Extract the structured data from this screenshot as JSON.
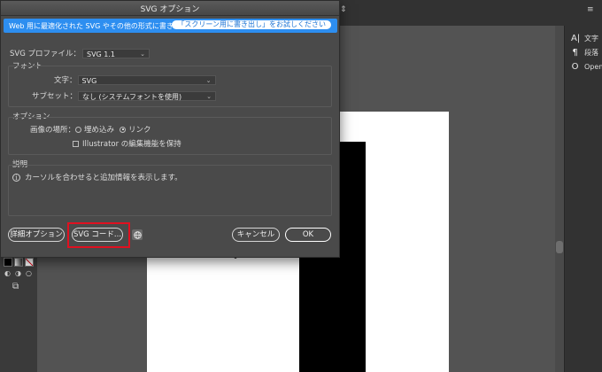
{
  "app": {
    "topbar_items": [
      "≡",
      "⇕"
    ],
    "right_panel": [
      {
        "icon": "character-icon",
        "glyph": "A|",
        "label": "文字"
      },
      {
        "icon": "paragraph-icon",
        "glyph": "¶",
        "label": "段落"
      },
      {
        "icon": "opentype-icon",
        "glyph": "O",
        "label": "OpenT"
      }
    ]
  },
  "dialog": {
    "title": "SVG オプション",
    "banner": {
      "text": "Web 用に最適化された SVG やその他の形式に書き出します。",
      "button": "「スクリーン用に書き出し」をお試しください"
    },
    "profile": {
      "label": "SVG プロファイル：",
      "value": "SVG 1.1"
    },
    "font_group": {
      "title": "フォント",
      "type": {
        "label": "文字：",
        "value": "SVG"
      },
      "subset": {
        "label": "サブセット：",
        "value": "なし (システムフォントを使用)"
      }
    },
    "options_group": {
      "title": "オプション",
      "image_location_label": "画像の場所：",
      "embed_label": "埋め込み",
      "link_label": "リンク",
      "preserve_label": "Illustrator の編集機能を保持"
    },
    "description_group": {
      "title": "説明",
      "text": "カーソルを合わせると追加情報を表示します。"
    },
    "buttons": {
      "advanced": "詳細オプション",
      "svg_code": "SVG コード...",
      "cancel": "キャンセル",
      "ok": "OK"
    }
  },
  "colors": {
    "banner_blue": "#2d8ef0",
    "highlight_red": "#e01020",
    "dialog_bg": "#4a4a4a"
  }
}
